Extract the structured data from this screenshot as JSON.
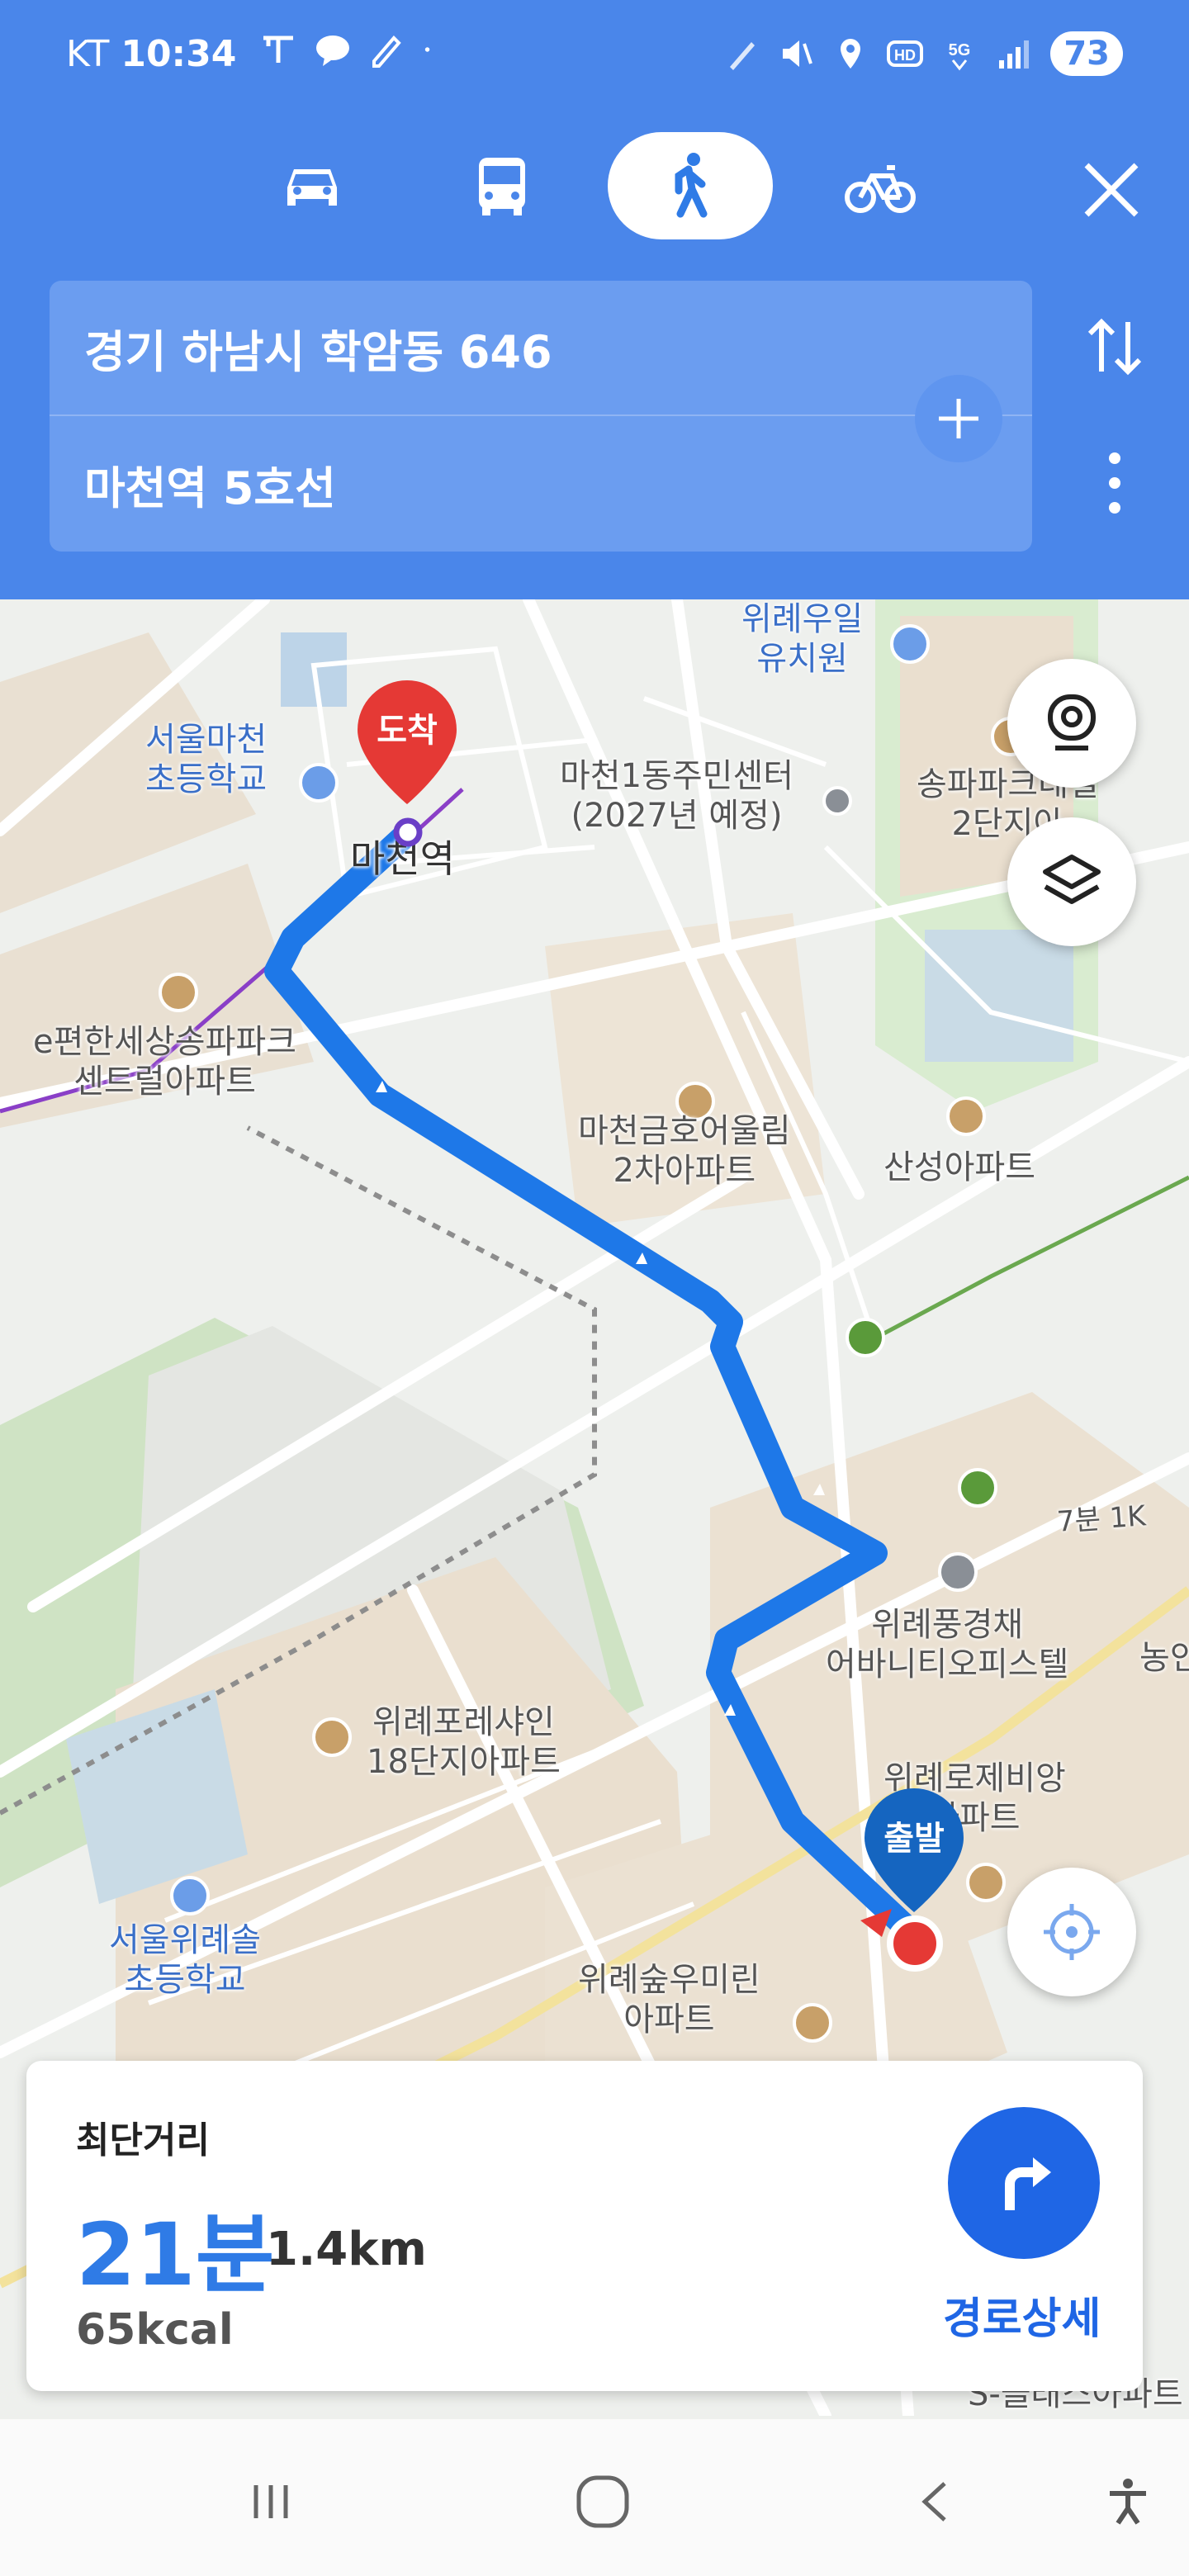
{
  "status_bar": {
    "carrier": "KT",
    "time": "10:34",
    "battery": "73"
  },
  "transport_modes": [
    {
      "name": "car",
      "icon": "car-icon",
      "active": false
    },
    {
      "name": "transit",
      "icon": "bus-icon",
      "active": false
    },
    {
      "name": "walk",
      "icon": "walk-icon",
      "active": true
    },
    {
      "name": "bike",
      "icon": "bike-icon",
      "active": false
    }
  ],
  "route_inputs": {
    "origin": "경기 하남시 학암동 646",
    "destination": "마천역 5호선"
  },
  "map": {
    "destination_pin_label": "도착",
    "origin_pin_label": "출발",
    "station_label": "마천역",
    "places": {
      "school_seoul_macheon": "서울마천\n초등학교",
      "kindergarten": "위례우일\n유치원",
      "community_center": "마천1동주민센터\n(2027년 예정)",
      "songpa_park_2": "송파파크데일\n2단지아",
      "e_apt": "e편한세상송파파크\n센트럴아파트",
      "macheon_kumho": "마천금호어울림\n2차아파트",
      "sansung_apt": "산성아파트",
      "wirye_office": "위례풍경채\n어바니티오피스텔",
      "forest_apt": "위례포레샤인\n18단지아파트",
      "roje_apt": "위례로제비앙\n아파트",
      "school_wirye": "서울위례솔\n초등학교",
      "woomirin_apt": "위례숲우미린\n아파트",
      "nong": "농인",
      "s_class": "S-클래스아파트",
      "trail_hint": "7분 1K"
    },
    "colors": {
      "route": "#1e78e8",
      "destination_pin": "#e53935",
      "origin_pin": "#1565c0",
      "header": "#4a86ea"
    }
  },
  "route_summary": {
    "type_label": "최단거리",
    "duration": "21분",
    "distance": "1.4km",
    "calories": "65kcal",
    "detail_label": "경로상세"
  }
}
